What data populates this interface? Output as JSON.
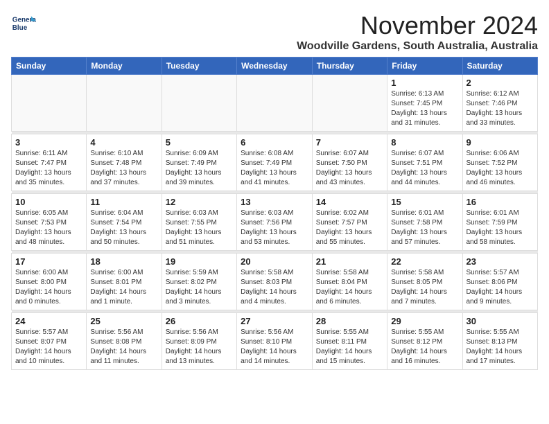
{
  "header": {
    "logo_line1": "General",
    "logo_line2": "Blue",
    "month": "November 2024",
    "location": "Woodville Gardens, South Australia, Australia"
  },
  "weekdays": [
    "Sunday",
    "Monday",
    "Tuesday",
    "Wednesday",
    "Thursday",
    "Friday",
    "Saturday"
  ],
  "weeks": [
    [
      {
        "day": "",
        "info": ""
      },
      {
        "day": "",
        "info": ""
      },
      {
        "day": "",
        "info": ""
      },
      {
        "day": "",
        "info": ""
      },
      {
        "day": "",
        "info": ""
      },
      {
        "day": "1",
        "info": "Sunrise: 6:13 AM\nSunset: 7:45 PM\nDaylight: 13 hours and 31 minutes."
      },
      {
        "day": "2",
        "info": "Sunrise: 6:12 AM\nSunset: 7:46 PM\nDaylight: 13 hours and 33 minutes."
      }
    ],
    [
      {
        "day": "3",
        "info": "Sunrise: 6:11 AM\nSunset: 7:47 PM\nDaylight: 13 hours and 35 minutes."
      },
      {
        "day": "4",
        "info": "Sunrise: 6:10 AM\nSunset: 7:48 PM\nDaylight: 13 hours and 37 minutes."
      },
      {
        "day": "5",
        "info": "Sunrise: 6:09 AM\nSunset: 7:49 PM\nDaylight: 13 hours and 39 minutes."
      },
      {
        "day": "6",
        "info": "Sunrise: 6:08 AM\nSunset: 7:49 PM\nDaylight: 13 hours and 41 minutes."
      },
      {
        "day": "7",
        "info": "Sunrise: 6:07 AM\nSunset: 7:50 PM\nDaylight: 13 hours and 43 minutes."
      },
      {
        "day": "8",
        "info": "Sunrise: 6:07 AM\nSunset: 7:51 PM\nDaylight: 13 hours and 44 minutes."
      },
      {
        "day": "9",
        "info": "Sunrise: 6:06 AM\nSunset: 7:52 PM\nDaylight: 13 hours and 46 minutes."
      }
    ],
    [
      {
        "day": "10",
        "info": "Sunrise: 6:05 AM\nSunset: 7:53 PM\nDaylight: 13 hours and 48 minutes."
      },
      {
        "day": "11",
        "info": "Sunrise: 6:04 AM\nSunset: 7:54 PM\nDaylight: 13 hours and 50 minutes."
      },
      {
        "day": "12",
        "info": "Sunrise: 6:03 AM\nSunset: 7:55 PM\nDaylight: 13 hours and 51 minutes."
      },
      {
        "day": "13",
        "info": "Sunrise: 6:03 AM\nSunset: 7:56 PM\nDaylight: 13 hours and 53 minutes."
      },
      {
        "day": "14",
        "info": "Sunrise: 6:02 AM\nSunset: 7:57 PM\nDaylight: 13 hours and 55 minutes."
      },
      {
        "day": "15",
        "info": "Sunrise: 6:01 AM\nSunset: 7:58 PM\nDaylight: 13 hours and 57 minutes."
      },
      {
        "day": "16",
        "info": "Sunrise: 6:01 AM\nSunset: 7:59 PM\nDaylight: 13 hours and 58 minutes."
      }
    ],
    [
      {
        "day": "17",
        "info": "Sunrise: 6:00 AM\nSunset: 8:00 PM\nDaylight: 14 hours and 0 minutes."
      },
      {
        "day": "18",
        "info": "Sunrise: 6:00 AM\nSunset: 8:01 PM\nDaylight: 14 hours and 1 minute."
      },
      {
        "day": "19",
        "info": "Sunrise: 5:59 AM\nSunset: 8:02 PM\nDaylight: 14 hours and 3 minutes."
      },
      {
        "day": "20",
        "info": "Sunrise: 5:58 AM\nSunset: 8:03 PM\nDaylight: 14 hours and 4 minutes."
      },
      {
        "day": "21",
        "info": "Sunrise: 5:58 AM\nSunset: 8:04 PM\nDaylight: 14 hours and 6 minutes."
      },
      {
        "day": "22",
        "info": "Sunrise: 5:58 AM\nSunset: 8:05 PM\nDaylight: 14 hours and 7 minutes."
      },
      {
        "day": "23",
        "info": "Sunrise: 5:57 AM\nSunset: 8:06 PM\nDaylight: 14 hours and 9 minutes."
      }
    ],
    [
      {
        "day": "24",
        "info": "Sunrise: 5:57 AM\nSunset: 8:07 PM\nDaylight: 14 hours and 10 minutes."
      },
      {
        "day": "25",
        "info": "Sunrise: 5:56 AM\nSunset: 8:08 PM\nDaylight: 14 hours and 11 minutes."
      },
      {
        "day": "26",
        "info": "Sunrise: 5:56 AM\nSunset: 8:09 PM\nDaylight: 14 hours and 13 minutes."
      },
      {
        "day": "27",
        "info": "Sunrise: 5:56 AM\nSunset: 8:10 PM\nDaylight: 14 hours and 14 minutes."
      },
      {
        "day": "28",
        "info": "Sunrise: 5:55 AM\nSunset: 8:11 PM\nDaylight: 14 hours and 15 minutes."
      },
      {
        "day": "29",
        "info": "Sunrise: 5:55 AM\nSunset: 8:12 PM\nDaylight: 14 hours and 16 minutes."
      },
      {
        "day": "30",
        "info": "Sunrise: 5:55 AM\nSunset: 8:13 PM\nDaylight: 14 hours and 17 minutes."
      }
    ]
  ]
}
